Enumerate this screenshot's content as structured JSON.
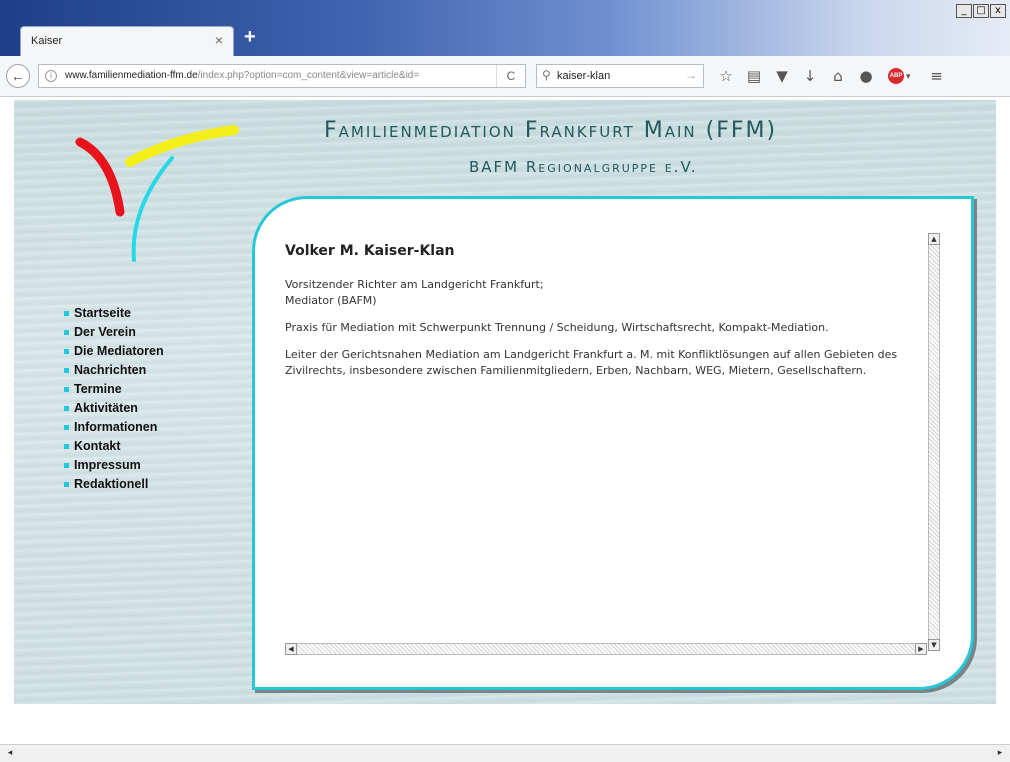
{
  "browser": {
    "tab_title": "Kaiser",
    "tab_close": "×",
    "new_tab": "+",
    "window_controls": [
      "_",
      "□",
      "x"
    ],
    "url_domain": "www.familienmediation-ffm.de",
    "url_path": "/index.php?option=com_content&view=article&id=",
    "search_value": "kaiser-klan",
    "icons": [
      "back-arrow-icon",
      "info-icon",
      "reload-icon",
      "search-icon",
      "go-arrow-icon",
      "bookmark-star-icon",
      "reading-list-icon",
      "pocket-icon",
      "download-icon",
      "home-icon",
      "chat-icon",
      "adblock-plus-icon",
      "menu-icon"
    ]
  },
  "site": {
    "title": "Familienmediation Frankfurt Main (FFM)",
    "subtitle": "BAFM Regionalgruppe e.V.",
    "logo_colors": {
      "red": "#e8141c",
      "yellow": "#f4ef1a",
      "cyan": "#27d8e6"
    }
  },
  "nav": {
    "items": [
      {
        "label": "Startseite"
      },
      {
        "label": "Der Verein"
      },
      {
        "label": "Die Mediatoren"
      },
      {
        "label": "Nachrichten"
      },
      {
        "label": "Termine"
      },
      {
        "label": "Aktivitäten"
      },
      {
        "label": "Informationen"
      },
      {
        "label": "Kontakt"
      },
      {
        "label": "Impressum"
      },
      {
        "label": "Redaktionell"
      }
    ]
  },
  "article": {
    "title": "Volker M. Kaiser-Klan",
    "p1_line1": "Vorsitzender Richter am Landgericht Frankfurt;",
    "p1_line2": "Mediator (BAFM)",
    "p2": "Praxis für Mediation mit Schwerpunkt Trennung / Scheidung, Wirtschaftsrecht, Kompakt-Mediation.",
    "p3": "Leiter der Gerichtsnahen Mediation am Landgericht Frankfurt a. M. mit Konfliktlösungen auf allen Gebieten des Zivilrechts, insbesondere zwischen Familienmitgliedern, Erben, Nachbarn, WEG, Mietern, Gesellschaftern."
  }
}
